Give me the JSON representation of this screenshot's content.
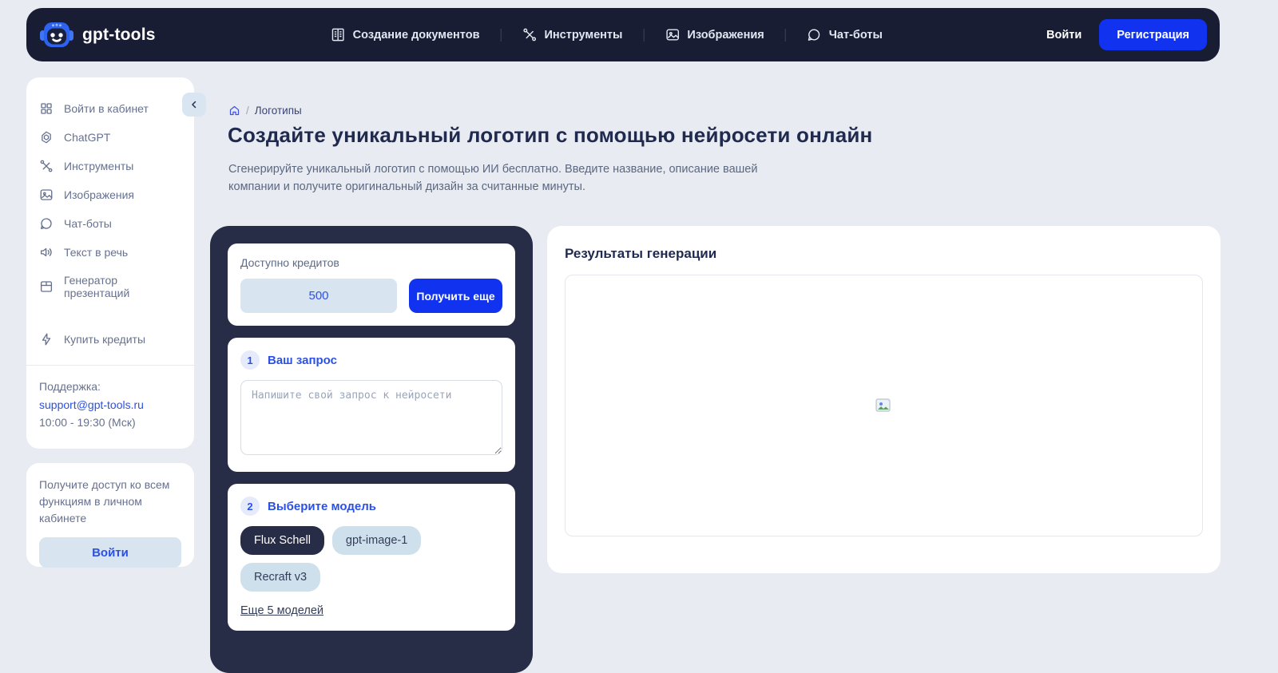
{
  "nav": {
    "brand": "gpt-tools",
    "items": [
      {
        "label": "Создание документов",
        "icon": "document-icon"
      },
      {
        "label": "Инструменты",
        "icon": "tools-icon"
      },
      {
        "label": "Изображения",
        "icon": "image-icon"
      },
      {
        "label": "Чат-боты",
        "icon": "chat-icon"
      }
    ],
    "login_label": "Войти",
    "register_label": "Регистрация"
  },
  "sidebar": {
    "items": [
      {
        "label": "Войти в кабинет",
        "icon": "dashboard-grid-icon"
      },
      {
        "label": "ChatGPT",
        "icon": "chatgpt-icon"
      },
      {
        "label": "Инструменты",
        "icon": "tools-icon"
      },
      {
        "label": "Изображения",
        "icon": "image-icon"
      },
      {
        "label": "Чат-боты",
        "icon": "chat-icon"
      },
      {
        "label": "Текст в речь",
        "icon": "speaker-icon"
      },
      {
        "label": "Генератор презентаций",
        "icon": "presentation-icon"
      },
      {
        "label": "Купить кредиты",
        "icon": "lightning-icon"
      }
    ],
    "support_label": "Поддержка:",
    "support_email": "support@gpt-tools.ru",
    "support_hours": "10:00 - 19:30 (Мск)",
    "promo_text": "Получите доступ ко всем функциям в личном кабинете",
    "promo_button": "Войти"
  },
  "main": {
    "breadcrumb": {
      "separator": "/",
      "page": "Логотипы"
    },
    "title": "Создайте уникальный логотип с помощью нейросети онлайн",
    "subtitle": "Сгенерируйте уникальный логотип с помощью ИИ бесплатно. Введите название, описание вашей компании и получите оригинальный дизайн за считанные минуты."
  },
  "generator": {
    "credits_label": "Доступно кредитов",
    "credits_value": "500",
    "get_more_label": "Получить еще",
    "step1": {
      "number": "1",
      "label": "Ваш запрос",
      "placeholder": "Напишите свой запрос к нейросети"
    },
    "step2": {
      "number": "2",
      "label": "Выберите модель",
      "models": [
        {
          "name": "Flux Schell",
          "selected": true
        },
        {
          "name": "gpt-image-1",
          "selected": false
        },
        {
          "name": "Recraft v3",
          "selected": false
        }
      ],
      "more_link": "Еще 5 моделей"
    }
  },
  "results": {
    "title": "Результаты генерации"
  },
  "colors": {
    "accent_blue": "#1133f0",
    "navbar_bg": "#181d33",
    "dark_card_bg": "#272c47",
    "link_blue": "#2b50e8",
    "light_pill": "#d8e4f0"
  }
}
